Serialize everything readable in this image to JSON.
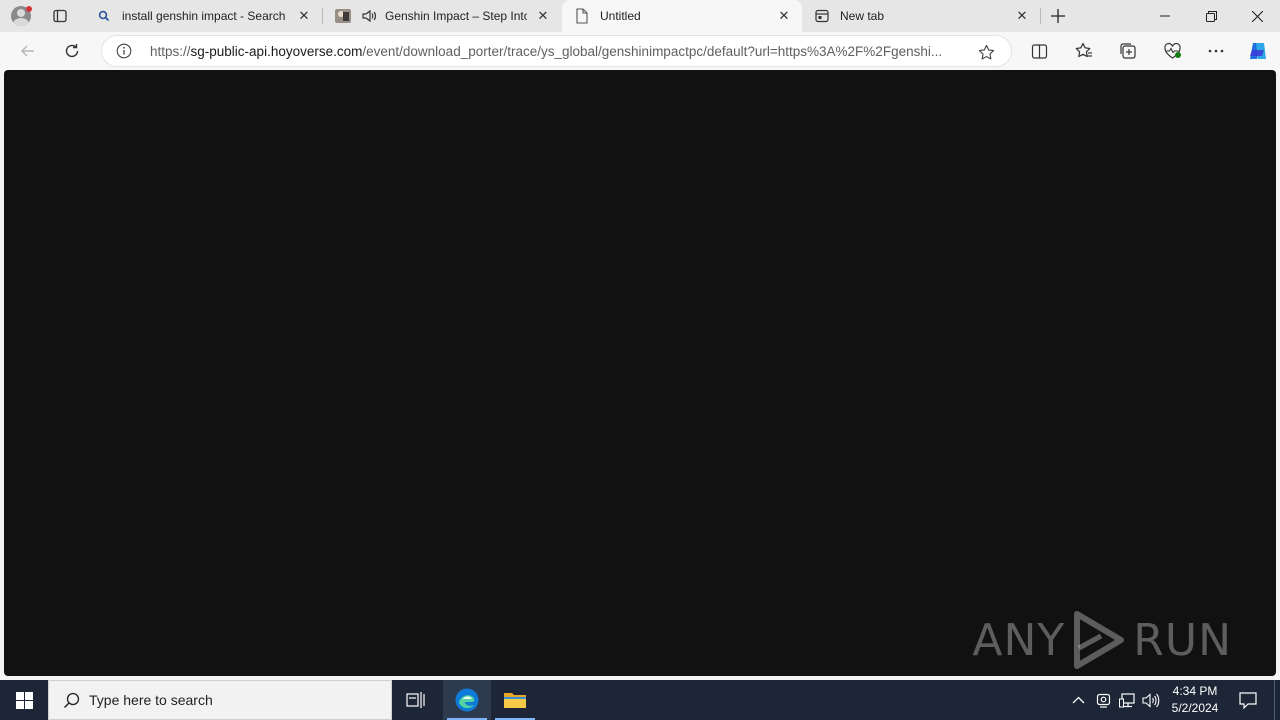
{
  "tabs": [
    {
      "title": "install genshin impact - Search",
      "icon": "search-icon"
    },
    {
      "title": "Genshin Impact – Step Into",
      "icon": "game-thumbnail-icon"
    },
    {
      "title": "Untitled",
      "icon": "page-icon"
    },
    {
      "title": "New tab",
      "icon": "newtab-icon"
    }
  ],
  "address_bar": {
    "url_prefix": "https://",
    "url_host": "sg-public-api.hoyoverse.com",
    "url_path": "/event/download_porter/trace/ys_global/genshinimpactpc/default?url=https%3A%2F%2Fgenshi..."
  },
  "watermark": {
    "left": "ANY",
    "right": "RUN"
  },
  "taskbar": {
    "search_placeholder": "Type here to search",
    "time": "4:34 PM",
    "date": "5/2/2024"
  },
  "colors": {
    "content_bg": "#111111",
    "taskbar_bg": "#1c2636",
    "accent": "#0078d4"
  }
}
